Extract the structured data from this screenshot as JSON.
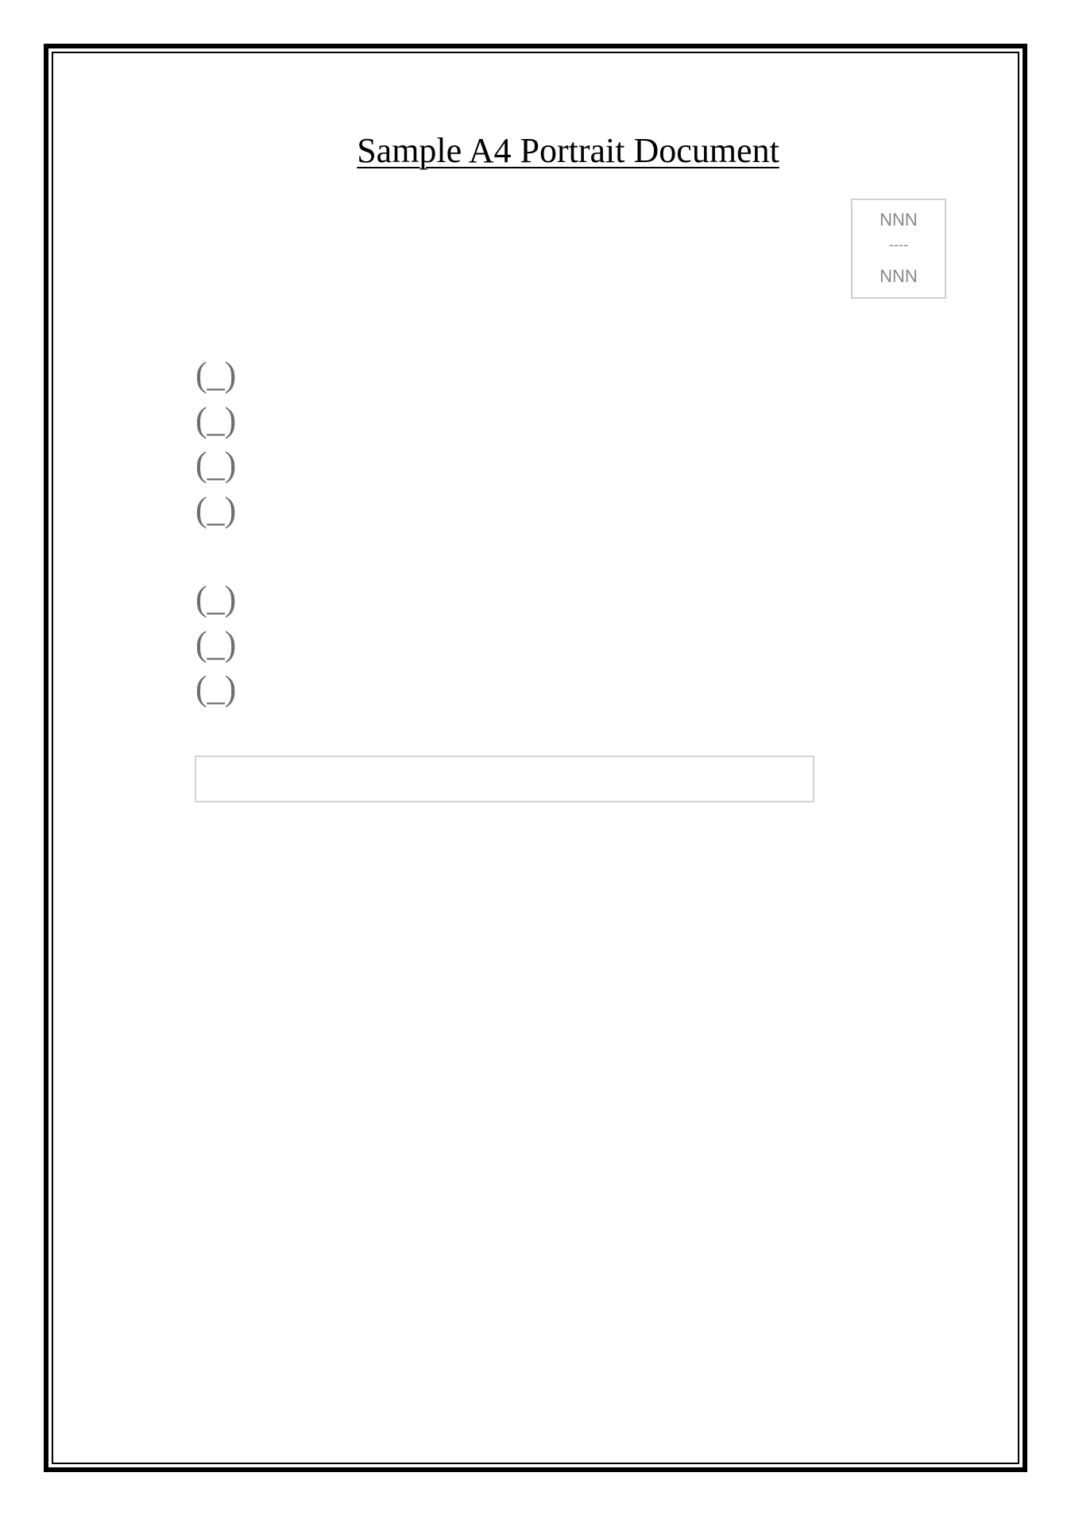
{
  "document": {
    "title": "Sample A4 Portrait Document",
    "code_box": {
      "top": "NNN",
      "separator": "----",
      "bottom": "NNN"
    },
    "options_group_1": [
      "(_)",
      "(_)",
      "(_)",
      "(_)"
    ],
    "options_group_2": [
      "(_)",
      "(_)",
      "(_)"
    ],
    "answer_field": {
      "value": ""
    }
  }
}
